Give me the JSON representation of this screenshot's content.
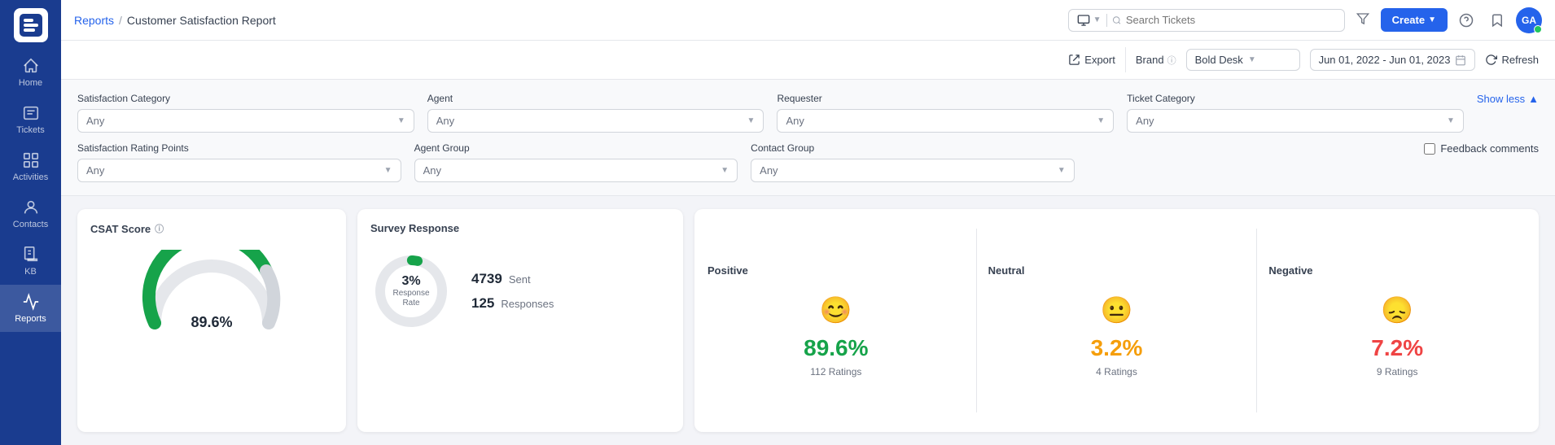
{
  "sidebar": {
    "logo_text": "B",
    "items": [
      {
        "id": "home",
        "label": "Home",
        "icon": "home"
      },
      {
        "id": "tickets",
        "label": "Tickets",
        "icon": "tickets"
      },
      {
        "id": "activities",
        "label": "Activities",
        "icon": "activities"
      },
      {
        "id": "contacts",
        "label": "Contacts",
        "icon": "contacts"
      },
      {
        "id": "kb",
        "label": "KB",
        "icon": "kb"
      },
      {
        "id": "reports",
        "label": "Reports",
        "icon": "reports",
        "active": true
      }
    ]
  },
  "topnav": {
    "breadcrumb_link": "Reports",
    "breadcrumb_sep": "/",
    "breadcrumb_current": "Customer Satisfaction Report",
    "search_placeholder": "Search Tickets",
    "create_label": "Create"
  },
  "toolbar": {
    "export_label": "Export",
    "brand_label": "Brand",
    "brand_value": "Bold Desk",
    "date_range": "Jun 01, 2022 - Jun 01, 2023",
    "refresh_label": "Refresh"
  },
  "filters": {
    "row1": [
      {
        "id": "satisfaction_category",
        "label": "Satisfaction Category",
        "value": "Any"
      },
      {
        "id": "agent",
        "label": "Agent",
        "value": "Any"
      },
      {
        "id": "requester",
        "label": "Requester",
        "value": "Any"
      },
      {
        "id": "ticket_category",
        "label": "Ticket Category",
        "value": "Any"
      }
    ],
    "row2": [
      {
        "id": "satisfaction_rating",
        "label": "Satisfaction Rating Points",
        "value": "Any"
      },
      {
        "id": "agent_group",
        "label": "Agent Group",
        "value": "Any"
      },
      {
        "id": "contact_group",
        "label": "Contact Group",
        "value": "Any"
      }
    ],
    "show_less_label": "Show less",
    "feedback_label": "Feedback comments"
  },
  "csat_card": {
    "title": "CSAT Score",
    "score": "89.6%",
    "gauge_value": 89.6,
    "colors": {
      "fill": "#16a34a",
      "bg": "#e5e7eb"
    }
  },
  "survey_card": {
    "title": "Survey Response",
    "response_rate_pct": "3%",
    "response_rate_label": "Response Rate",
    "sent": 4739,
    "sent_label": "Sent",
    "responses": 125,
    "responses_label": "Responses"
  },
  "sentiment": {
    "positive": {
      "label": "Positive",
      "pct": "89.6%",
      "ratings": "112 Ratings"
    },
    "neutral": {
      "label": "Neutral",
      "pct": "3.2%",
      "ratings": "4 Ratings"
    },
    "negative": {
      "label": "Negative",
      "pct": "7.2%",
      "ratings": "9 Ratings"
    }
  }
}
